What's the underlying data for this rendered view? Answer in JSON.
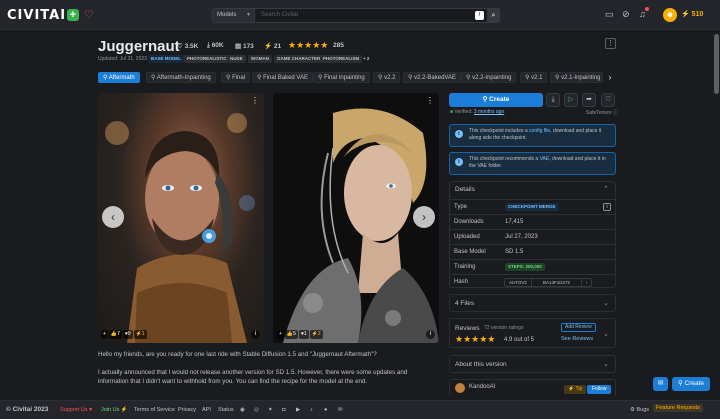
{
  "topbar": {
    "logo": "CIVITAI",
    "search_type": "Models",
    "search_placeholder": "Search Civitai",
    "search_shortcut": "/",
    "buzz": "510"
  },
  "model": {
    "title": "Juggernaut",
    "likes": "3.5K",
    "downloads": "60K",
    "collected": "173",
    "tipped": "21",
    "rating_count": "285",
    "stars": "★★★★★",
    "updated": "Updated: Jul 31, 2023",
    "tags": [
      "BASE MODEL",
      "PHOTOREALISTIC",
      "NUDE",
      "WOMAN",
      "GAME CHARACTER",
      "PHOTOREALISM",
      "+ 2"
    ]
  },
  "versions": [
    "Aftermath",
    "Aftermath-Inpainting",
    "Final",
    "Final Baked VAE",
    "Final Inpainting",
    "v2.2",
    "v2.2-BakedVAE",
    "v2.2-Inpainting",
    "v2.1",
    "v2.1-Inpainting"
  ],
  "images": [
    {
      "reactions": [
        "+",
        "7",
        "9",
        "1"
      ]
    },
    {
      "reactions": [
        "+",
        "5",
        "1",
        "2"
      ]
    }
  ],
  "description": [
    "Hello my friends, are you ready for one last ride with Stable Diffusion 1.5 and \"Juggernaut Aftermath\"?",
    "I actually announced that I would not release another version for SD 1.5. However, there were some updates and",
    "information that I didn't want to withhold from you. You can find the recipe for the model at the end."
  ],
  "sidebar": {
    "create_label": "Create",
    "verified_label": "Verified:",
    "verified_when": "3 months ago",
    "safetensor": "SafeTensor",
    "alert1_pre": "This checkpoint includes a ",
    "alert1_link": "config file",
    "alert1_post": ", download and place it along side the checkpoint.",
    "alert2_pre": "This checkpoint recommends a ",
    "alert2_link": "VAE",
    "alert2_post": ", download and place it in the VAE folder.",
    "details_label": "Details",
    "details": {
      "type_k": "Type",
      "type_v": "CHECKPOINT MERGE",
      "downloads_k": "Downloads",
      "downloads_v": "17,415",
      "uploaded_k": "Uploaded",
      "uploaded_v": "Jul 27, 2023",
      "base_k": "Base Model",
      "base_v": "SD 1.5",
      "training_k": "Training",
      "training_v": "STEPS: 200,000",
      "hash_k": "Hash",
      "hash_algo": "AUTOV2",
      "hash_v": "BA13F1D272"
    },
    "files_label": "4 Files",
    "reviews_label": "Reviews",
    "reviews_count": "72 version ratings",
    "add_review": "Add Review",
    "rating": "4.9 out of 5",
    "see_reviews": "See Reviews",
    "about_label": "About this version",
    "creator": "KandooAI",
    "tip": "Tip",
    "follow": "Follow"
  },
  "footer": {
    "copyright": "© Civitai 2023",
    "support": "Support Us",
    "join": "Join Us",
    "tos": "Terms of Service",
    "privacy": "Privacy",
    "api": "API",
    "status": "Status",
    "bugs": "Bugs",
    "feature": "Feature Requests",
    "create": "Create"
  },
  "colors": {
    "accent": "#1c7ed6",
    "star": "#fab005",
    "bg": "#1a1b1e"
  }
}
